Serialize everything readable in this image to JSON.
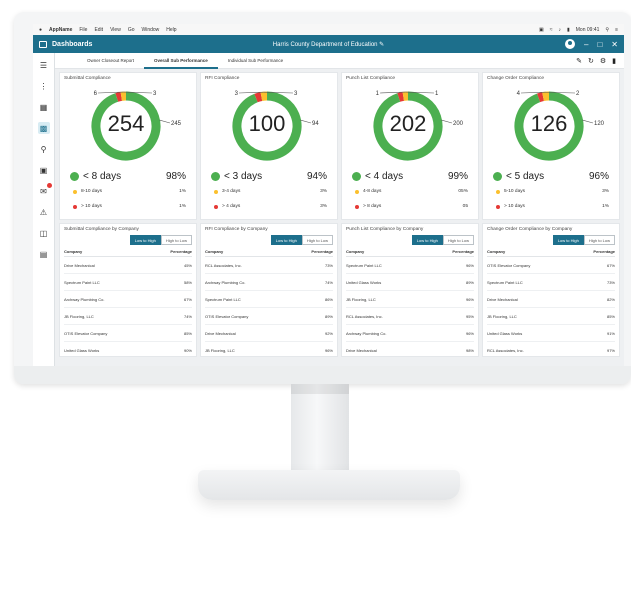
{
  "macbar": {
    "app_name": "AppName",
    "menu": [
      "File",
      "Edit",
      "View",
      "Go",
      "Window",
      "Help"
    ],
    "clock": "Mon 09:41"
  },
  "appbar": {
    "title": "Dashboards",
    "org": "Harris County Department of Education"
  },
  "tabs": [
    "Owner Closeout Report",
    "Overall Sub Performance",
    "Individual Sub Performance"
  ],
  "active_tab": 1,
  "colors": {
    "primary": "#1d6f8c",
    "green": "#4caf50",
    "yellow": "#fbc02d",
    "red": "#e53935",
    "accent_icons": "#1d6f8c"
  },
  "sidebar_icons": [
    "menu-icon",
    "timeline-icon",
    "grid-icon",
    "dashboard-icon",
    "search-icon",
    "clipboard-icon",
    "mail-icon",
    "warning-icon",
    "folders-icon",
    "document-icon"
  ],
  "donuts": [
    {
      "title": "Submittal Compliance",
      "total": "254",
      "green_count": "245",
      "yellow_count": "6",
      "red_count": "3",
      "green_label": "< 8 days",
      "green_pct": "98%",
      "yellow_label": "8-10 days",
      "yellow_pct": "1%",
      "red_label": "> 10 days",
      "red_pct": "1%"
    },
    {
      "title": "RFI Compliance",
      "total": "100",
      "green_count": "94",
      "yellow_count": "3",
      "red_count": "3",
      "green_label": "< 3 days",
      "green_pct": "94%",
      "yellow_label": "3-4 days",
      "yellow_pct": "3%",
      "red_label": "> 4 days",
      "red_pct": "3%"
    },
    {
      "title": "Punch List Compliance",
      "total": "202",
      "green_count": "200",
      "yellow_count": "1",
      "red_count": "1",
      "green_label": "< 4 days",
      "green_pct": "99%",
      "yellow_label": "4-8 days",
      "yellow_pct": "05%",
      "red_label": "> 8 days",
      "red_pct": "05"
    },
    {
      "title": "Change Order Compliance",
      "total": "126",
      "green_count": "120",
      "yellow_count": "4",
      "red_count": "2",
      "green_label": "< 5 days",
      "green_pct": "96%",
      "yellow_label": "5-10 days",
      "yellow_pct": "3%",
      "red_label": "> 10 days",
      "red_pct": "1%"
    }
  ],
  "tables": [
    {
      "title": "Submittal Compliance by Company",
      "sort_on": "Low to High",
      "sort_off": "High to Low",
      "col_company": "Company",
      "col_pct": "Percentage",
      "rows": [
        {
          "company": "Drive Mechanical",
          "pct": "45%"
        },
        {
          "company": "Spectrum Paint LLC",
          "pct": "58%"
        },
        {
          "company": "Archway Plumbing Co.",
          "pct": "67%"
        },
        {
          "company": "JB Flooring, LLC",
          "pct": "74%"
        },
        {
          "company": "OTIS Elevator Company",
          "pct": "85%"
        },
        {
          "company": "United Glass Works",
          "pct": "90%"
        }
      ]
    },
    {
      "title": "RFI Compliance by Company",
      "sort_on": "Low to High",
      "sort_off": "High to Low",
      "col_company": "Company",
      "col_pct": "Percentage",
      "rows": [
        {
          "company": "RCL Associates, Inc.",
          "pct": "73%"
        },
        {
          "company": "Archway Plumbing Co.",
          "pct": "74%"
        },
        {
          "company": "Spectrum Paint LLC",
          "pct": "86%"
        },
        {
          "company": "OTIS Elevator Company",
          "pct": "89%"
        },
        {
          "company": "Drive Mechanical",
          "pct": "92%"
        },
        {
          "company": "JB Flooring, LLC",
          "pct": "96%"
        }
      ]
    },
    {
      "title": "Punch List Compliance by Company",
      "sort_on": "Low to High",
      "sort_off": "High to Low",
      "col_company": "Company",
      "col_pct": "Percentage",
      "rows": [
        {
          "company": "Spectrum Paint LLC",
          "pct": "96%"
        },
        {
          "company": "United Glass Works",
          "pct": "89%"
        },
        {
          "company": "JB Flooring, LLC",
          "pct": "96%"
        },
        {
          "company": "RCL Associates, Inc.",
          "pct": "95%"
        },
        {
          "company": "Archway Plumbing Co.",
          "pct": "96%"
        },
        {
          "company": "Drive Mechanical",
          "pct": "98%"
        }
      ]
    },
    {
      "title": "Change Order Compliance by Company",
      "sort_on": "Low to High",
      "sort_off": "High to Low",
      "col_company": "Company",
      "col_pct": "Percentage",
      "rows": [
        {
          "company": "OTIS Elevator Company",
          "pct": "67%"
        },
        {
          "company": "Spectrum Paint LLC",
          "pct": "73%"
        },
        {
          "company": "Drive Mechanical",
          "pct": "82%"
        },
        {
          "company": "JB Flooring, LLC",
          "pct": "85%"
        },
        {
          "company": "United Glass Works",
          "pct": "91%"
        },
        {
          "company": "RCL Associates, Inc.",
          "pct": "97%"
        }
      ]
    }
  ]
}
